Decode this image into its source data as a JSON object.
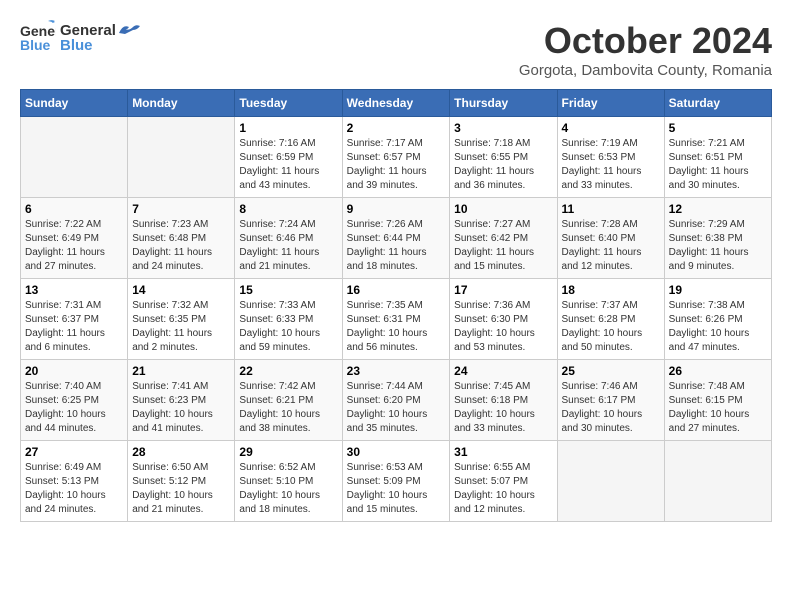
{
  "header": {
    "logo_general": "General",
    "logo_blue": "Blue",
    "month_title": "October 2024",
    "location": "Gorgota, Dambovita County, Romania"
  },
  "days_of_week": [
    "Sunday",
    "Monday",
    "Tuesday",
    "Wednesday",
    "Thursday",
    "Friday",
    "Saturday"
  ],
  "weeks": [
    [
      {
        "day": "",
        "info": ""
      },
      {
        "day": "",
        "info": ""
      },
      {
        "day": "1",
        "info": "Sunrise: 7:16 AM\nSunset: 6:59 PM\nDaylight: 11 hours and 43 minutes."
      },
      {
        "day": "2",
        "info": "Sunrise: 7:17 AM\nSunset: 6:57 PM\nDaylight: 11 hours and 39 minutes."
      },
      {
        "day": "3",
        "info": "Sunrise: 7:18 AM\nSunset: 6:55 PM\nDaylight: 11 hours and 36 minutes."
      },
      {
        "day": "4",
        "info": "Sunrise: 7:19 AM\nSunset: 6:53 PM\nDaylight: 11 hours and 33 minutes."
      },
      {
        "day": "5",
        "info": "Sunrise: 7:21 AM\nSunset: 6:51 PM\nDaylight: 11 hours and 30 minutes."
      }
    ],
    [
      {
        "day": "6",
        "info": "Sunrise: 7:22 AM\nSunset: 6:49 PM\nDaylight: 11 hours and 27 minutes."
      },
      {
        "day": "7",
        "info": "Sunrise: 7:23 AM\nSunset: 6:48 PM\nDaylight: 11 hours and 24 minutes."
      },
      {
        "day": "8",
        "info": "Sunrise: 7:24 AM\nSunset: 6:46 PM\nDaylight: 11 hours and 21 minutes."
      },
      {
        "day": "9",
        "info": "Sunrise: 7:26 AM\nSunset: 6:44 PM\nDaylight: 11 hours and 18 minutes."
      },
      {
        "day": "10",
        "info": "Sunrise: 7:27 AM\nSunset: 6:42 PM\nDaylight: 11 hours and 15 minutes."
      },
      {
        "day": "11",
        "info": "Sunrise: 7:28 AM\nSunset: 6:40 PM\nDaylight: 11 hours and 12 minutes."
      },
      {
        "day": "12",
        "info": "Sunrise: 7:29 AM\nSunset: 6:38 PM\nDaylight: 11 hours and 9 minutes."
      }
    ],
    [
      {
        "day": "13",
        "info": "Sunrise: 7:31 AM\nSunset: 6:37 PM\nDaylight: 11 hours and 6 minutes."
      },
      {
        "day": "14",
        "info": "Sunrise: 7:32 AM\nSunset: 6:35 PM\nDaylight: 11 hours and 2 minutes."
      },
      {
        "day": "15",
        "info": "Sunrise: 7:33 AM\nSunset: 6:33 PM\nDaylight: 10 hours and 59 minutes."
      },
      {
        "day": "16",
        "info": "Sunrise: 7:35 AM\nSunset: 6:31 PM\nDaylight: 10 hours and 56 minutes."
      },
      {
        "day": "17",
        "info": "Sunrise: 7:36 AM\nSunset: 6:30 PM\nDaylight: 10 hours and 53 minutes."
      },
      {
        "day": "18",
        "info": "Sunrise: 7:37 AM\nSunset: 6:28 PM\nDaylight: 10 hours and 50 minutes."
      },
      {
        "day": "19",
        "info": "Sunrise: 7:38 AM\nSunset: 6:26 PM\nDaylight: 10 hours and 47 minutes."
      }
    ],
    [
      {
        "day": "20",
        "info": "Sunrise: 7:40 AM\nSunset: 6:25 PM\nDaylight: 10 hours and 44 minutes."
      },
      {
        "day": "21",
        "info": "Sunrise: 7:41 AM\nSunset: 6:23 PM\nDaylight: 10 hours and 41 minutes."
      },
      {
        "day": "22",
        "info": "Sunrise: 7:42 AM\nSunset: 6:21 PM\nDaylight: 10 hours and 38 minutes."
      },
      {
        "day": "23",
        "info": "Sunrise: 7:44 AM\nSunset: 6:20 PM\nDaylight: 10 hours and 35 minutes."
      },
      {
        "day": "24",
        "info": "Sunrise: 7:45 AM\nSunset: 6:18 PM\nDaylight: 10 hours and 33 minutes."
      },
      {
        "day": "25",
        "info": "Sunrise: 7:46 AM\nSunset: 6:17 PM\nDaylight: 10 hours and 30 minutes."
      },
      {
        "day": "26",
        "info": "Sunrise: 7:48 AM\nSunset: 6:15 PM\nDaylight: 10 hours and 27 minutes."
      }
    ],
    [
      {
        "day": "27",
        "info": "Sunrise: 6:49 AM\nSunset: 5:13 PM\nDaylight: 10 hours and 24 minutes."
      },
      {
        "day": "28",
        "info": "Sunrise: 6:50 AM\nSunset: 5:12 PM\nDaylight: 10 hours and 21 minutes."
      },
      {
        "day": "29",
        "info": "Sunrise: 6:52 AM\nSunset: 5:10 PM\nDaylight: 10 hours and 18 minutes."
      },
      {
        "day": "30",
        "info": "Sunrise: 6:53 AM\nSunset: 5:09 PM\nDaylight: 10 hours and 15 minutes."
      },
      {
        "day": "31",
        "info": "Sunrise: 6:55 AM\nSunset: 5:07 PM\nDaylight: 10 hours and 12 minutes."
      },
      {
        "day": "",
        "info": ""
      },
      {
        "day": "",
        "info": ""
      }
    ]
  ]
}
